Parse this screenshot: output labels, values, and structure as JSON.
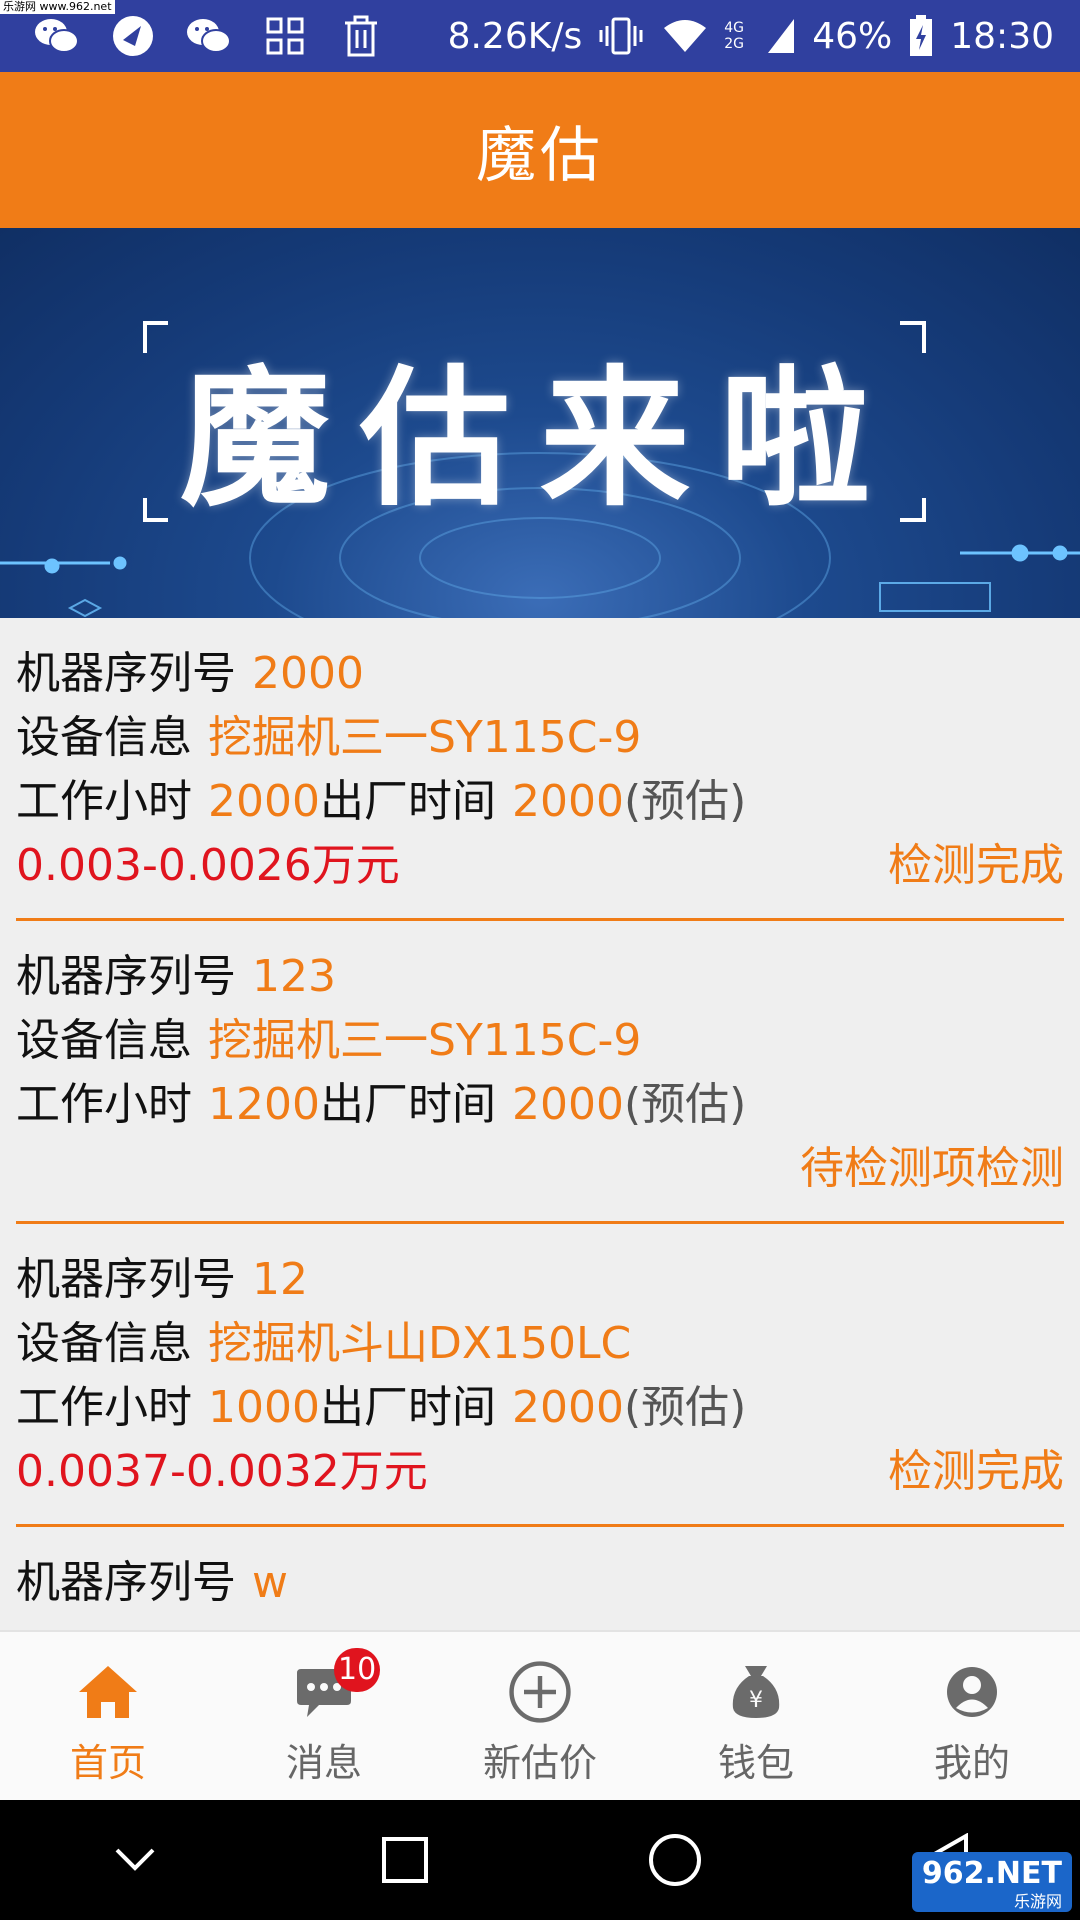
{
  "status_bar": {
    "watermark": "乐游网 www.962.net",
    "speed": "8.26K/s",
    "network": "4G 2G",
    "battery": "46%",
    "time": "18:30",
    "left_icons": [
      "wechat-icon",
      "qq-browser-icon",
      "wechat-icon",
      "apps-icon",
      "trash-icon"
    ],
    "right_icons": [
      "vibrate-icon",
      "wifi-icon",
      "signal-icon",
      "battery-icon"
    ]
  },
  "header": {
    "title": "魔估"
  },
  "banner": {
    "text": "魔估来啦"
  },
  "labels": {
    "serial": "机器序列号",
    "device": "设备信息",
    "hours": "工作小时",
    "factory": "出厂时间",
    "estimate": "(预估)"
  },
  "items": [
    {
      "serial": "2000",
      "device": "挖掘机三一SY115C-9",
      "hours": "2000",
      "factory_year": "2000",
      "price": "0.003-0.0026万元",
      "status": "检测完成"
    },
    {
      "serial": "123",
      "device": "挖掘机三一SY115C-9",
      "hours": "1200",
      "factory_year": "2000",
      "price": "",
      "status": "待检测项检测"
    },
    {
      "serial": "12",
      "device": "挖掘机斗山DX150LC",
      "hours": "1000",
      "factory_year": "2000",
      "price": "0.0037-0.0032万元",
      "status": "检测完成"
    },
    {
      "serial": "w"
    }
  ],
  "bottom_nav": [
    {
      "label": "首页",
      "icon": "home-icon",
      "active": true
    },
    {
      "label": "消息",
      "icon": "message-icon",
      "badge": "10"
    },
    {
      "label": "新估价",
      "icon": "add-circle-icon"
    },
    {
      "label": "钱包",
      "icon": "wallet-icon"
    },
    {
      "label": "我的",
      "icon": "profile-icon"
    }
  ],
  "system_nav": [
    "back-down-icon",
    "recents-icon",
    "home-circle-icon",
    "back-icon"
  ],
  "watermark_bottom": {
    "main": "962.NET",
    "sub": "乐游网"
  },
  "colors": {
    "accent": "#f07c17",
    "status_bar": "#30409f",
    "price": "#e0141e"
  }
}
